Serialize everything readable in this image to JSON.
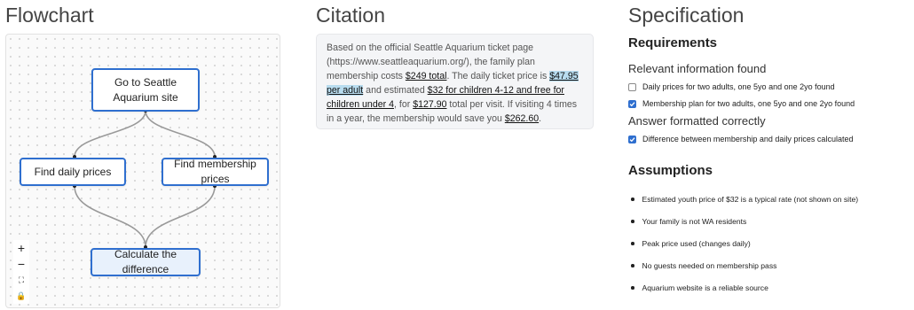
{
  "flowchart": {
    "title": "Flowchart",
    "nodes": {
      "start": "Go to Seattle Aquarium site",
      "daily": "Find daily prices",
      "membership": "Find membership prices",
      "calc": "Calculate the difference"
    },
    "controls": {
      "zoom_in": "+",
      "zoom_out": "−",
      "fit": "⛶",
      "lock": "🔒"
    }
  },
  "citation": {
    "title": "Citation",
    "t1": "Based on the official Seattle Aquarium ticket page (https://www.seattleaquarium.org/), the family plan membership costs ",
    "l1": "$249 total",
    "t2": ". The daily ticket price is ",
    "l2": "$47.95 per adult",
    "t3": " and estimated ",
    "l3": "$32 for children 4-12 and free for children under 4",
    "t4": ", for ",
    "l4": "$127.90",
    "t5": " total per visit. If visiting 4 times in a year, the membership would save you ",
    "l5": "$262.60",
    "t6": "."
  },
  "specification": {
    "title": "Specification",
    "requirements_heading": "Requirements",
    "group1_heading": "Relevant information found",
    "group1_items": [
      {
        "label": "Daily prices for two adults, one 5yo and one 2yo found",
        "checked": false
      },
      {
        "label": "Membership plan for two adults, one 5yo and one 2yo found",
        "checked": true
      }
    ],
    "group2_heading": "Answer formatted correctly",
    "group2_items": [
      {
        "label": "Difference between membership and daily prices calculated",
        "checked": true
      }
    ],
    "assumptions_heading": "Assumptions",
    "assumptions": [
      "Estimated youth price of $32 is a typical rate (not shown on site)",
      "Your family is not WA residents",
      "Peak price used (changes daily)",
      "No guests needed on membership pass",
      "Aquarium website is a reliable source"
    ]
  },
  "colors": {
    "accent": "#2f6fcf",
    "edge": "#999999",
    "highlight": "#b8dcef"
  }
}
